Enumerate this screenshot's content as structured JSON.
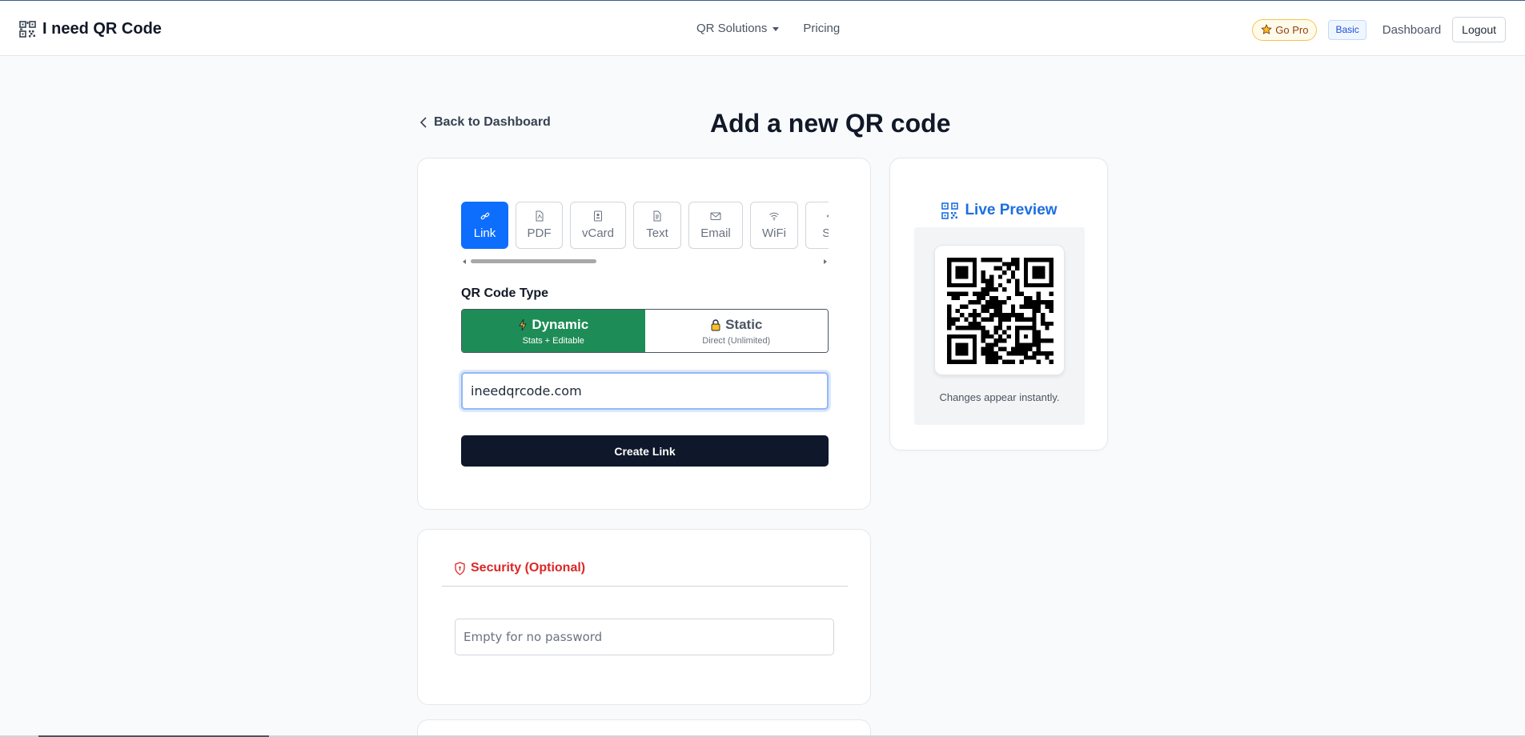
{
  "brand": {
    "name": "I need QR Code",
    "icon": "qr-icon"
  },
  "nav": {
    "solutions": "QR Solutions",
    "pricing": "Pricing",
    "go_pro": "Go Pro",
    "plan_badge": "Basic",
    "dashboard": "Dashboard",
    "logout": "Logout"
  },
  "page": {
    "back_label": "Back to Dashboard",
    "title": "Add a new QR code"
  },
  "tabs": [
    {
      "label": "Link",
      "icon": "link-icon",
      "active": true
    },
    {
      "label": "PDF",
      "icon": "pdf-icon",
      "active": false
    },
    {
      "label": "vCard",
      "icon": "vcard-icon",
      "active": false
    },
    {
      "label": "Text",
      "icon": "text-icon",
      "active": false
    },
    {
      "label": "Email",
      "icon": "email-icon",
      "active": false
    },
    {
      "label": "WiFi",
      "icon": "wifi-icon",
      "active": false
    },
    {
      "label": "Sc",
      "icon": "social-icon",
      "active": false
    }
  ],
  "qr_type": {
    "label": "QR Code Type",
    "dynamic": {
      "title": "Dynamic",
      "subtitle": "Stats + Editable",
      "icon": "lightning-icon",
      "selected": true
    },
    "static": {
      "title": "Static",
      "subtitle": "Direct (Unlimited)",
      "icon": "lock-icon",
      "selected": false
    }
  },
  "form": {
    "url_value": "ineedqrcode.com",
    "create_button": "Create Link"
  },
  "security": {
    "title": "Security (Optional)",
    "password_placeholder": "Empty for no password"
  },
  "preview": {
    "title": "Live Preview",
    "caption": "Changes appear instantly."
  },
  "colors": {
    "primary": "#0d6efd",
    "dynamic_green": "#1e8c56",
    "danger": "#dc2626",
    "dark_button": "#0f172a",
    "preview_blue": "#1d6fe0"
  }
}
